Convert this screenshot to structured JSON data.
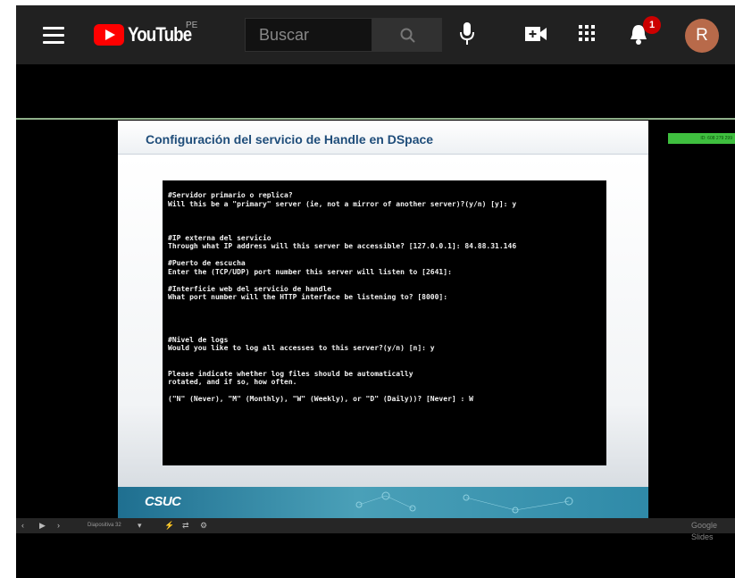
{
  "header": {
    "logo_text": "YouTube",
    "country": "PE",
    "search_placeholder": "Buscar",
    "notification_count": "1",
    "avatar_initial": "R"
  },
  "slide": {
    "title": "Configuración del servicio de Handle en DSpace",
    "terminal_lines": "#Servidor primario o replica?\nWill this be a \"primary\" server (ie, not a mirror of another server)?(y/n) [y]: y\n\n\n\n#IP externa del servicio\nThrough what IP address will this server be accessible? [127.0.0.1]: 84.88.31.146\n\n#Puerto de escucha\nEnter the (TCP/UDP) port number this server will listen to [2641]:\n\n#Interficie web del servicio de handle\nWhat port number will the HTTP interface be listening to? [8000]:\n\n\n\n\n#Nivel de logs\nWould you like to log all accesses to this server?(y/n) [n]: y\n\n\nPlease indicate whether log files should be automatically\nrotated, and if so, how often.\n\n(\"N\" (Never), \"M\" (Monthly), \"W\" (Weekly), or \"D\" (Daily))? [Never] : W",
    "footer_logo": "CSUC"
  },
  "id_tag": "ID: 608 279 299",
  "controls": {
    "slide_label": "Diapositiva 32",
    "brand": "Google Slides"
  }
}
